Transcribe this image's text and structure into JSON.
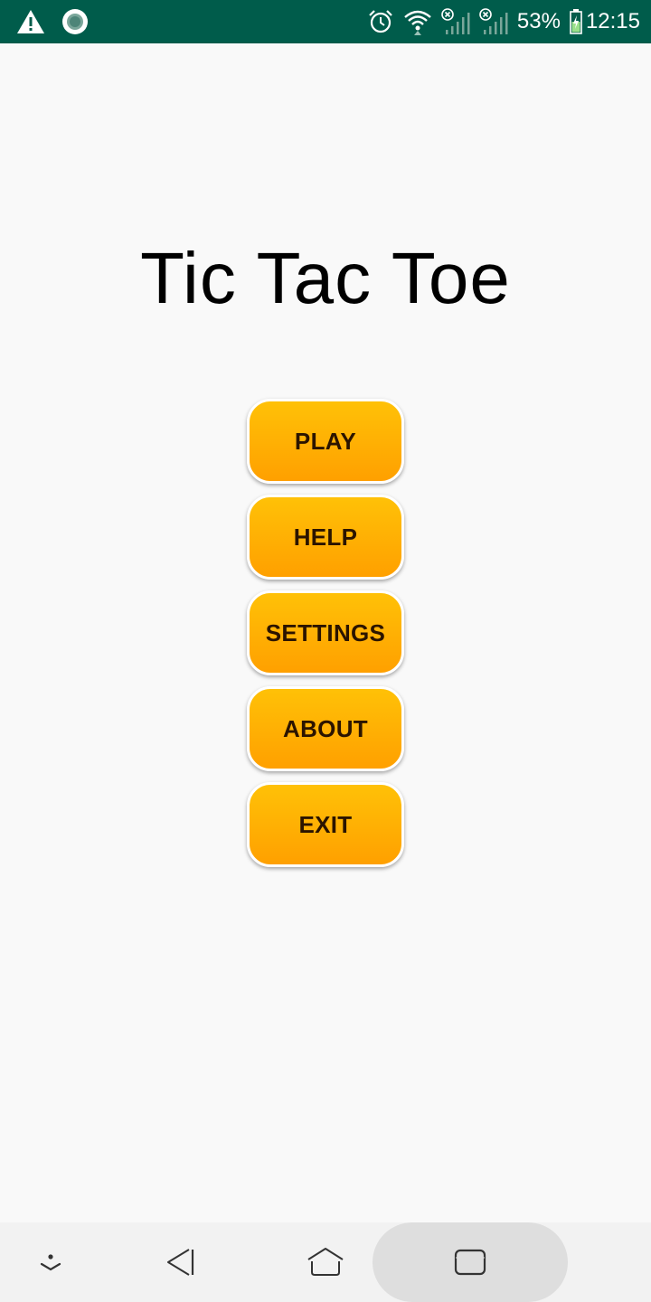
{
  "status_bar": {
    "battery_percent": "53%",
    "time": "12:15",
    "icons": [
      "warning-icon",
      "record-icon",
      "alarm-icon",
      "wifi-icon",
      "signal-icon",
      "signal-icon",
      "battery-icon"
    ]
  },
  "main": {
    "title": "Tic Tac Toe",
    "menu": [
      {
        "label": "PLAY"
      },
      {
        "label": "HELP"
      },
      {
        "label": "SETTINGS"
      },
      {
        "label": "ABOUT"
      },
      {
        "label": "EXIT"
      }
    ]
  },
  "nav_bar": {
    "buttons": [
      "hide-nav-icon",
      "back-icon",
      "home-icon",
      "recents-icon"
    ]
  },
  "colors": {
    "status_bar": "#005c4b",
    "button_top": "#ffc107",
    "button_bottom": "#ffa000",
    "background": "#f9f9f9"
  }
}
